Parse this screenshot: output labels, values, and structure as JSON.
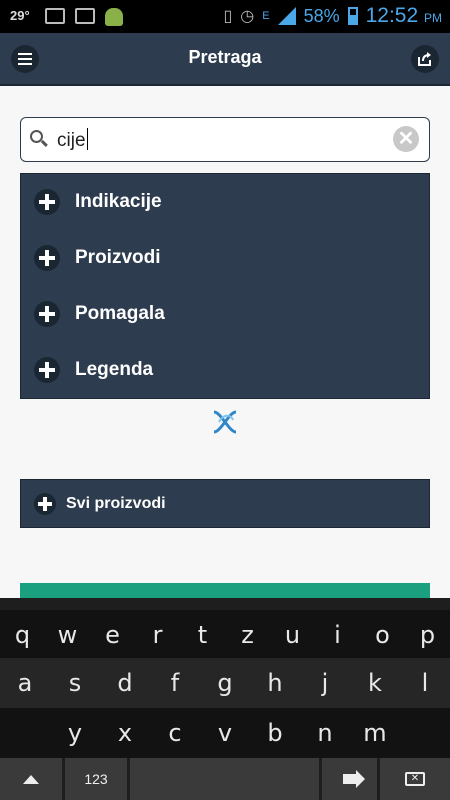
{
  "status_bar": {
    "temperature": "29°",
    "battery_percent": "58%",
    "time": "12:52",
    "time_suffix": "PM",
    "network": "E"
  },
  "header": {
    "title": "Pretraga"
  },
  "search": {
    "value": "cije"
  },
  "categories": [
    {
      "label": "Indikacije"
    },
    {
      "label": "Proizvodi"
    },
    {
      "label": "Pomagala"
    },
    {
      "label": "Legenda"
    }
  ],
  "all_products": {
    "label": "Svi proizvodi"
  },
  "keyboard": {
    "row1": [
      "q",
      "w",
      "e",
      "r",
      "t",
      "z",
      "u",
      "i",
      "o",
      "p"
    ],
    "row2": [
      "a",
      "s",
      "d",
      "f",
      "g",
      "h",
      "j",
      "k",
      "l"
    ],
    "row3": [
      "y",
      "x",
      "c",
      "v",
      "b",
      "n",
      "m"
    ],
    "numbers_label": "123"
  },
  "colors": {
    "header_bg": "#2d3c4e",
    "accent_teal": "#1a9f7f",
    "status_blue": "#4aa7e8"
  }
}
